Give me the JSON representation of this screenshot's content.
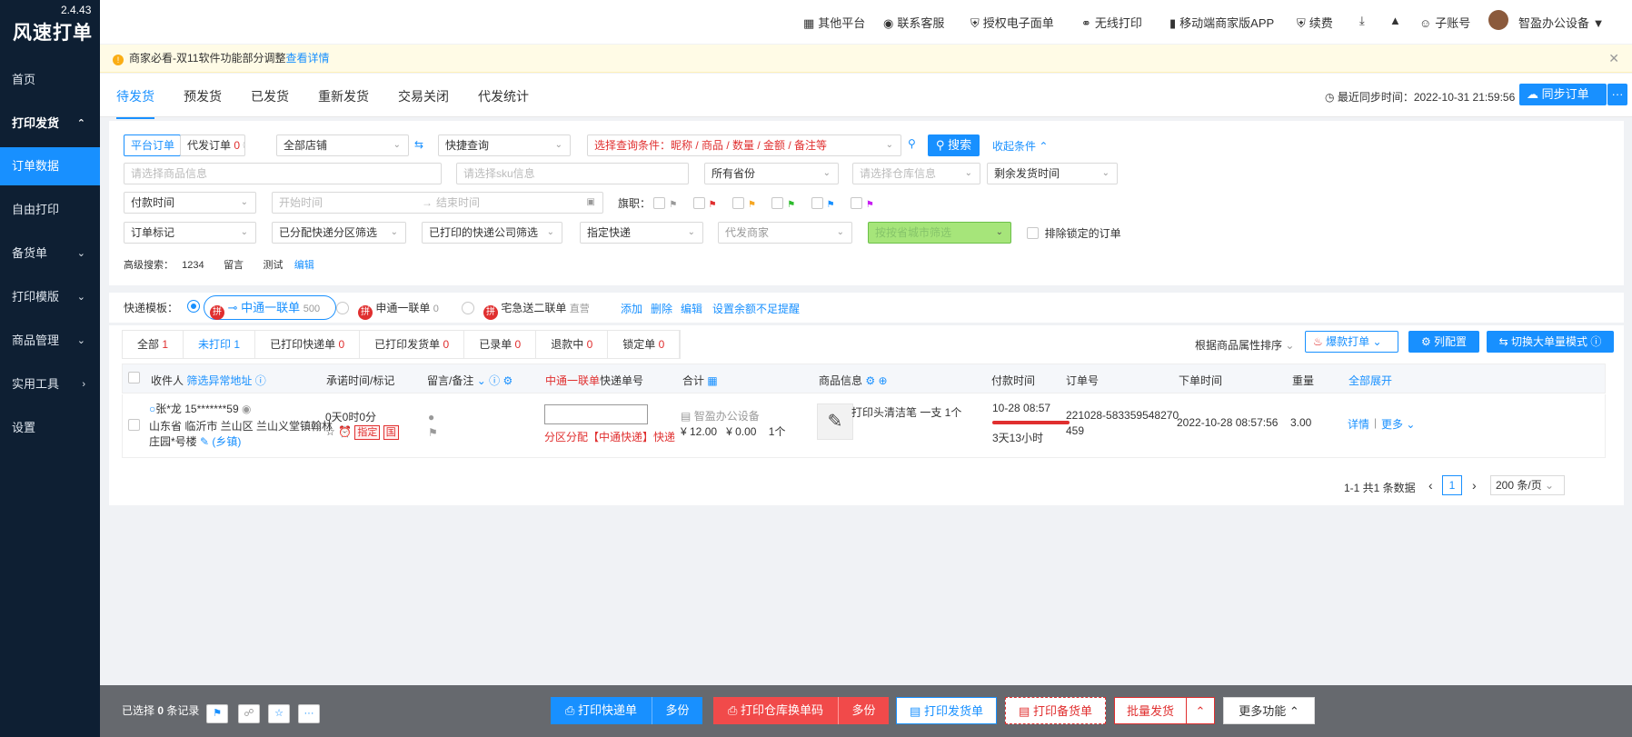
{
  "app": {
    "logo": "风速打单",
    "version": "2.4.43"
  },
  "sidebar": {
    "items": [
      {
        "label": "首页"
      },
      {
        "label": "打印发货",
        "chev": "^"
      },
      {
        "label": "订单数据"
      },
      {
        "label": "自由打印"
      },
      {
        "label": "备货单",
        "chev": "v"
      },
      {
        "label": "打印模版",
        "chev": "v"
      },
      {
        "label": "商品管理",
        "chev": "v"
      },
      {
        "label": "实用工具",
        "chev": ">"
      },
      {
        "label": "设置"
      }
    ]
  },
  "topbar": {
    "items": [
      "其他平台",
      "联系客服",
      "授权电子面单",
      "无线打印",
      "移动端商家版APP",
      "续费",
      "子账号"
    ],
    "user": "智盈办公设备"
  },
  "notice": {
    "text": "商家必看-双11软件功能部分调整",
    "link": "查看详情"
  },
  "tabs": [
    "待发货",
    "预发货",
    "已发货",
    "重新发货",
    "交易关闭",
    "代发统计"
  ],
  "sync": {
    "label": "最近同步时间：2022-10-31 21:59:56",
    "button": "同步订单",
    "more": "···"
  },
  "filters": {
    "platform_order": "平台订单",
    "daifa_order": "代发订单",
    "daifa_count": "0",
    "all_shops": "全部店铺",
    "quick_query": "快捷查询",
    "query_cond": "选择查询条件：昵称 / 商品 / 数量 / 金额 / 备注等",
    "search": "搜索",
    "collapse": "收起条件",
    "goods_ph": "请选择商品信息",
    "sku_ph": "请选择sku信息",
    "province": "所有省份",
    "warehouse_ph": "请选择仓库信息",
    "remaining_time": "剩余发货时间",
    "pay_time": "付款时间",
    "start_ph": "开始时间",
    "end_ph": "结束时间",
    "flags_label": "旗职：",
    "order_mark": "订单标记",
    "assigned_area": "已分配快递分区筛选",
    "printed_express": "已打印的快递公司筛选",
    "specified_express": "指定快递",
    "daifa_merchant": "代发商家",
    "city_ph": "按按省城市筛选",
    "exclude_locked": "排除锁定的订单",
    "advanced_label": "高级搜索：",
    "advanced_items": [
      "1234",
      "留言",
      "测试"
    ],
    "advanced_edit": "编辑"
  },
  "template": {
    "label": "快递模板：",
    "options": [
      {
        "name": "中通一联单",
        "count": "500"
      },
      {
        "name": "申通一联单",
        "count": "0"
      },
      {
        "name": "宅急送二联单",
        "count": "直营"
      }
    ],
    "actions": [
      "添加",
      "删除",
      "编辑",
      "设置余额不足提醒"
    ]
  },
  "subtabs": [
    {
      "label": "全部",
      "n": "1"
    },
    {
      "label": "未打印",
      "n": "1"
    },
    {
      "label": "已打印快递单",
      "n": "0"
    },
    {
      "label": "已打印发货单",
      "n": "0"
    },
    {
      "label": "已录单",
      "n": "0"
    },
    {
      "label": "退款中",
      "n": "0"
    },
    {
      "label": "锁定单",
      "n": "0"
    }
  ],
  "list_tools": {
    "sort": "根据商品属性排序",
    "hot": "爆款打单",
    "col": "列配置",
    "switch": "切换大单量模式"
  },
  "columns": {
    "receiver": "收件人",
    "filter_addr": "筛选异常地址",
    "promise": "承诺时间/标记",
    "memo": "留言/备注",
    "express_tpl": "中通一联单",
    "express_no": "快递单号",
    "total": "合计",
    "goods": "商品信息",
    "pay_time": "付款时间",
    "order_no": "订单号",
    "order_time": "下单时间",
    "weight": "重量",
    "expand": "全部展开"
  },
  "order": {
    "name": "张*龙 15*******59",
    "addr1": "山东省 临沂市 兰山区 兰山义堂镇翰林",
    "addr2": "庄园*号楼",
    "town": "(乡镇)",
    "promise": "0天0时0分",
    "tag_specified": "指定",
    "tag_round": "国",
    "area_note": "分区分配【中通快递】快递",
    "shop": "智盈办公设备",
    "price": "¥ 12.00",
    "discount": "¥ 0.00",
    "qty": "1个",
    "goods": "打印头清洁笔 一支 1个",
    "pay_time": "10-28 08:57",
    "remaining": "3天13小时",
    "order_no1": "221028-583359548270",
    "order_no2": "459",
    "order_time": "2022-10-28 08:57:56",
    "weight": "3.00",
    "detail": "详情",
    "more": "更多"
  },
  "pagination": {
    "summary": "1-1 共1 条数据",
    "page": "1",
    "size": "200 条/页"
  },
  "bottom": {
    "selected_prefix": "已选择",
    "selected_count": "0",
    "selected_suffix": "条记录",
    "print_express": "打印快递单",
    "multi1": "多份",
    "print_warehouse": "打印仓库换单码",
    "multi2": "多份",
    "print_invoice": "打印发货单",
    "print_stock": "打印备货单",
    "batch_ship": "批量发货",
    "more": "更多功能"
  }
}
